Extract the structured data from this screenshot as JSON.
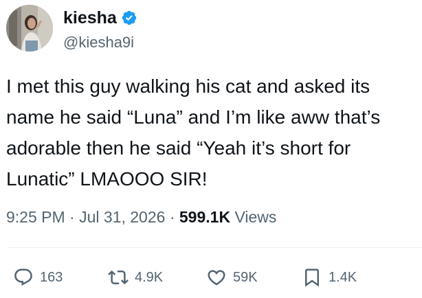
{
  "author": {
    "display_name": "kiesha",
    "handle": "@kiesha9i",
    "verified": true,
    "verified_color": "#1d9bf0"
  },
  "tweet": {
    "text": "I met this guy walking his cat and asked its\nname he said “Luna” and I’m like aww that’s\nadorable then he said “Yeah it’s short for\nLunatic” LMAOOO SIR!"
  },
  "meta": {
    "time": "9:25 PM",
    "separator": "·",
    "date": "Jul 31, 2026",
    "views_count": "599.1K",
    "views_label": "Views"
  },
  "actions": {
    "replies": {
      "icon": "reply-icon",
      "count": "163"
    },
    "retweets": {
      "icon": "retweet-icon",
      "count": "4.9K"
    },
    "likes": {
      "icon": "heart-icon",
      "count": "59K"
    },
    "bookmarks": {
      "icon": "bookmark-icon",
      "count": "1.4K"
    }
  },
  "colors": {
    "text_primary": "#0f1419",
    "text_secondary": "#536471",
    "divider": "#eff3f4"
  }
}
